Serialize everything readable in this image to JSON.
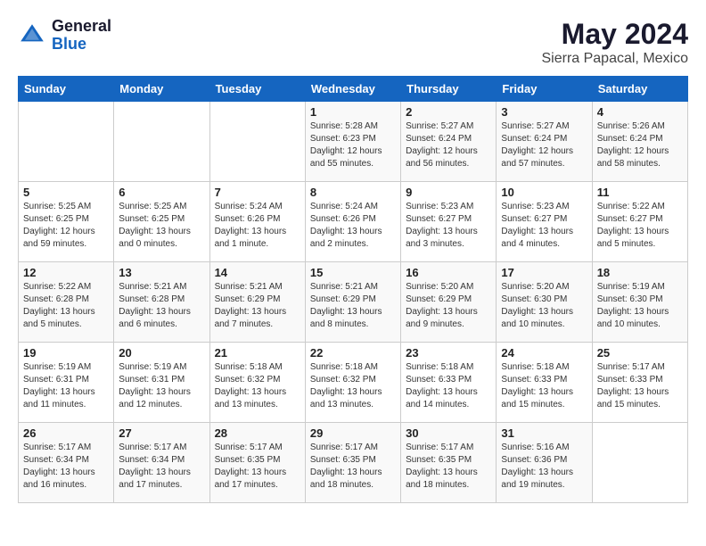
{
  "header": {
    "logo_general": "General",
    "logo_blue": "Blue",
    "title": "May 2024",
    "location": "Sierra Papacal, Mexico"
  },
  "days_of_week": [
    "Sunday",
    "Monday",
    "Tuesday",
    "Wednesday",
    "Thursday",
    "Friday",
    "Saturday"
  ],
  "weeks": [
    [
      {
        "day": "",
        "info": ""
      },
      {
        "day": "",
        "info": ""
      },
      {
        "day": "",
        "info": ""
      },
      {
        "day": "1",
        "info": "Sunrise: 5:28 AM\nSunset: 6:23 PM\nDaylight: 12 hours\nand 55 minutes."
      },
      {
        "day": "2",
        "info": "Sunrise: 5:27 AM\nSunset: 6:24 PM\nDaylight: 12 hours\nand 56 minutes."
      },
      {
        "day": "3",
        "info": "Sunrise: 5:27 AM\nSunset: 6:24 PM\nDaylight: 12 hours\nand 57 minutes."
      },
      {
        "day": "4",
        "info": "Sunrise: 5:26 AM\nSunset: 6:24 PM\nDaylight: 12 hours\nand 58 minutes."
      }
    ],
    [
      {
        "day": "5",
        "info": "Sunrise: 5:25 AM\nSunset: 6:25 PM\nDaylight: 12 hours\nand 59 minutes."
      },
      {
        "day": "6",
        "info": "Sunrise: 5:25 AM\nSunset: 6:25 PM\nDaylight: 13 hours\nand 0 minutes."
      },
      {
        "day": "7",
        "info": "Sunrise: 5:24 AM\nSunset: 6:26 PM\nDaylight: 13 hours\nand 1 minute."
      },
      {
        "day": "8",
        "info": "Sunrise: 5:24 AM\nSunset: 6:26 PM\nDaylight: 13 hours\nand 2 minutes."
      },
      {
        "day": "9",
        "info": "Sunrise: 5:23 AM\nSunset: 6:27 PM\nDaylight: 13 hours\nand 3 minutes."
      },
      {
        "day": "10",
        "info": "Sunrise: 5:23 AM\nSunset: 6:27 PM\nDaylight: 13 hours\nand 4 minutes."
      },
      {
        "day": "11",
        "info": "Sunrise: 5:22 AM\nSunset: 6:27 PM\nDaylight: 13 hours\nand 5 minutes."
      }
    ],
    [
      {
        "day": "12",
        "info": "Sunrise: 5:22 AM\nSunset: 6:28 PM\nDaylight: 13 hours\nand 5 minutes."
      },
      {
        "day": "13",
        "info": "Sunrise: 5:21 AM\nSunset: 6:28 PM\nDaylight: 13 hours\nand 6 minutes."
      },
      {
        "day": "14",
        "info": "Sunrise: 5:21 AM\nSunset: 6:29 PM\nDaylight: 13 hours\nand 7 minutes."
      },
      {
        "day": "15",
        "info": "Sunrise: 5:21 AM\nSunset: 6:29 PM\nDaylight: 13 hours\nand 8 minutes."
      },
      {
        "day": "16",
        "info": "Sunrise: 5:20 AM\nSunset: 6:29 PM\nDaylight: 13 hours\nand 9 minutes."
      },
      {
        "day": "17",
        "info": "Sunrise: 5:20 AM\nSunset: 6:30 PM\nDaylight: 13 hours\nand 10 minutes."
      },
      {
        "day": "18",
        "info": "Sunrise: 5:19 AM\nSunset: 6:30 PM\nDaylight: 13 hours\nand 10 minutes."
      }
    ],
    [
      {
        "day": "19",
        "info": "Sunrise: 5:19 AM\nSunset: 6:31 PM\nDaylight: 13 hours\nand 11 minutes."
      },
      {
        "day": "20",
        "info": "Sunrise: 5:19 AM\nSunset: 6:31 PM\nDaylight: 13 hours\nand 12 minutes."
      },
      {
        "day": "21",
        "info": "Sunrise: 5:18 AM\nSunset: 6:32 PM\nDaylight: 13 hours\nand 13 minutes."
      },
      {
        "day": "22",
        "info": "Sunrise: 5:18 AM\nSunset: 6:32 PM\nDaylight: 13 hours\nand 13 minutes."
      },
      {
        "day": "23",
        "info": "Sunrise: 5:18 AM\nSunset: 6:33 PM\nDaylight: 13 hours\nand 14 minutes."
      },
      {
        "day": "24",
        "info": "Sunrise: 5:18 AM\nSunset: 6:33 PM\nDaylight: 13 hours\nand 15 minutes."
      },
      {
        "day": "25",
        "info": "Sunrise: 5:17 AM\nSunset: 6:33 PM\nDaylight: 13 hours\nand 15 minutes."
      }
    ],
    [
      {
        "day": "26",
        "info": "Sunrise: 5:17 AM\nSunset: 6:34 PM\nDaylight: 13 hours\nand 16 minutes."
      },
      {
        "day": "27",
        "info": "Sunrise: 5:17 AM\nSunset: 6:34 PM\nDaylight: 13 hours\nand 17 minutes."
      },
      {
        "day": "28",
        "info": "Sunrise: 5:17 AM\nSunset: 6:35 PM\nDaylight: 13 hours\nand 17 minutes."
      },
      {
        "day": "29",
        "info": "Sunrise: 5:17 AM\nSunset: 6:35 PM\nDaylight: 13 hours\nand 18 minutes."
      },
      {
        "day": "30",
        "info": "Sunrise: 5:17 AM\nSunset: 6:35 PM\nDaylight: 13 hours\nand 18 minutes."
      },
      {
        "day": "31",
        "info": "Sunrise: 5:16 AM\nSunset: 6:36 PM\nDaylight: 13 hours\nand 19 minutes."
      },
      {
        "day": "",
        "info": ""
      }
    ]
  ]
}
